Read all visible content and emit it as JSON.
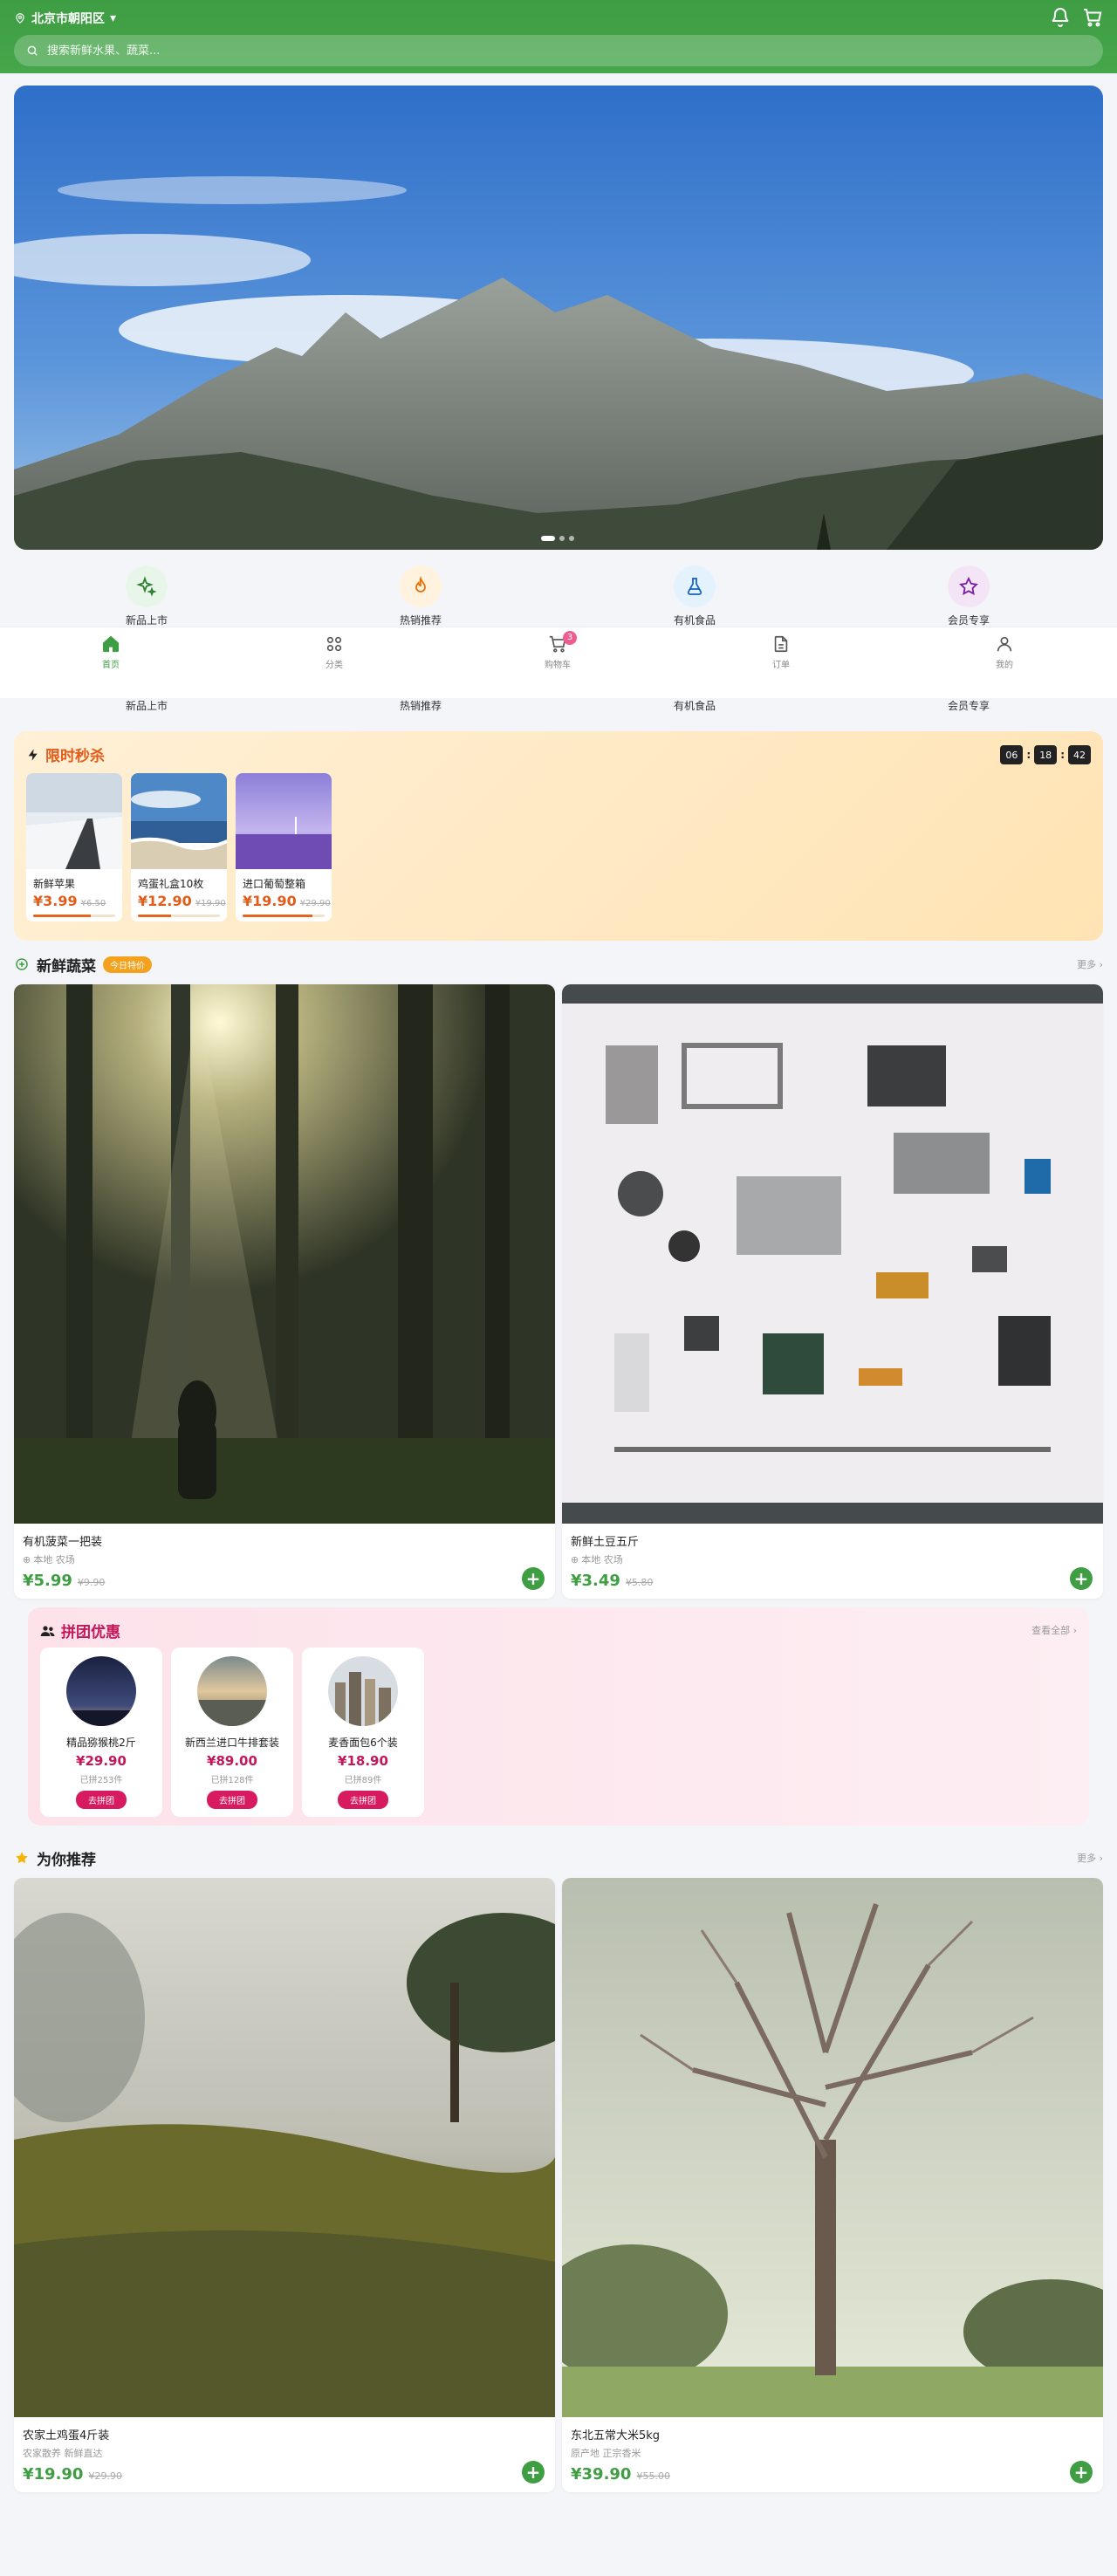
{
  "header": {
    "location": "北京市朝阳区",
    "location_arrow": "▾",
    "search_placeholder": "搜索新鲜水果、蔬菜..."
  },
  "banner": {
    "dots": 3,
    "active_dot": 0
  },
  "categories": [
    {
      "label": "新品上市",
      "icon": "sparkles-icon",
      "color": "#e8f5e9",
      "stroke": "#2e7d32"
    },
    {
      "label": "热销推荐",
      "icon": "flame-icon",
      "color": "#fff3e0",
      "stroke": "#ef6c00"
    },
    {
      "label": "有机食品",
      "icon": "flask-icon",
      "color": "#e3f2fd",
      "stroke": "#1565c0"
    },
    {
      "label": "会员专享",
      "icon": "star-icon",
      "color": "#f3e5f5",
      "stroke": "#7b1fa2"
    }
  ],
  "tabbar": {
    "tabs": [
      {
        "label": "首页",
        "icon": "home-icon",
        "active": true
      },
      {
        "label": "分类",
        "icon": "grid-icon",
        "active": false
      },
      {
        "label": "购物车",
        "icon": "cart-icon",
        "active": false,
        "badge": "3"
      },
      {
        "label": "订单",
        "icon": "document-icon",
        "active": false
      },
      {
        "label": "我的",
        "icon": "user-icon",
        "active": false
      }
    ]
  },
  "flash_sale": {
    "title": "限时秒杀",
    "countdown": [
      "06",
      "18",
      "42"
    ],
    "items": [
      {
        "name": "新鲜苹果",
        "price": "¥3.99",
        "old_price": "¥6.50",
        "sold": 0.7
      },
      {
        "name": "鸡蛋礼盒10枚",
        "price": "¥12.90",
        "old_price": "¥19.90",
        "sold": 0.4
      },
      {
        "name": "进口葡萄整箱",
        "price": "¥19.90",
        "old_price": "¥29.90",
        "sold": 0.85
      }
    ]
  },
  "fresh_section": {
    "title": "新鲜蔬菜",
    "tag": "今日特价",
    "more": "更多 ›",
    "items": [
      {
        "name": "有机菠菜一把装",
        "sub": "本地 农场",
        "price": "¥5.99",
        "old_price": "¥9.90"
      },
      {
        "name": "新鲜土豆五斤",
        "sub": "本地 农场",
        "price": "¥3.49",
        "old_price": "¥5.80"
      }
    ]
  },
  "group_buy": {
    "title": "拼团优惠",
    "more": "查看全部 ›",
    "items": [
      {
        "name": "精品猕猴桃2斤",
        "price": "¥29.90",
        "people": "已拼253件",
        "button": "去拼团"
      },
      {
        "name": "新西兰进口牛排套装",
        "price": "¥89.00",
        "people": "已拼128件",
        "button": "去拼团"
      },
      {
        "name": "麦香面包6个装",
        "price": "¥18.90",
        "people": "已拼89件",
        "button": "去拼团"
      }
    ]
  },
  "recommend_section": {
    "title": "为你推荐",
    "more": "更多 ›",
    "items": [
      {
        "name": "农家土鸡蛋4斤装",
        "sub": "农家散养 新鲜直达",
        "price": "¥19.90",
        "old_price": "¥29.90"
      },
      {
        "name": "东北五常大米5kg",
        "sub": "原产地 正宗香米",
        "price": "¥39.90",
        "old_price": "¥55.00"
      }
    ]
  }
}
